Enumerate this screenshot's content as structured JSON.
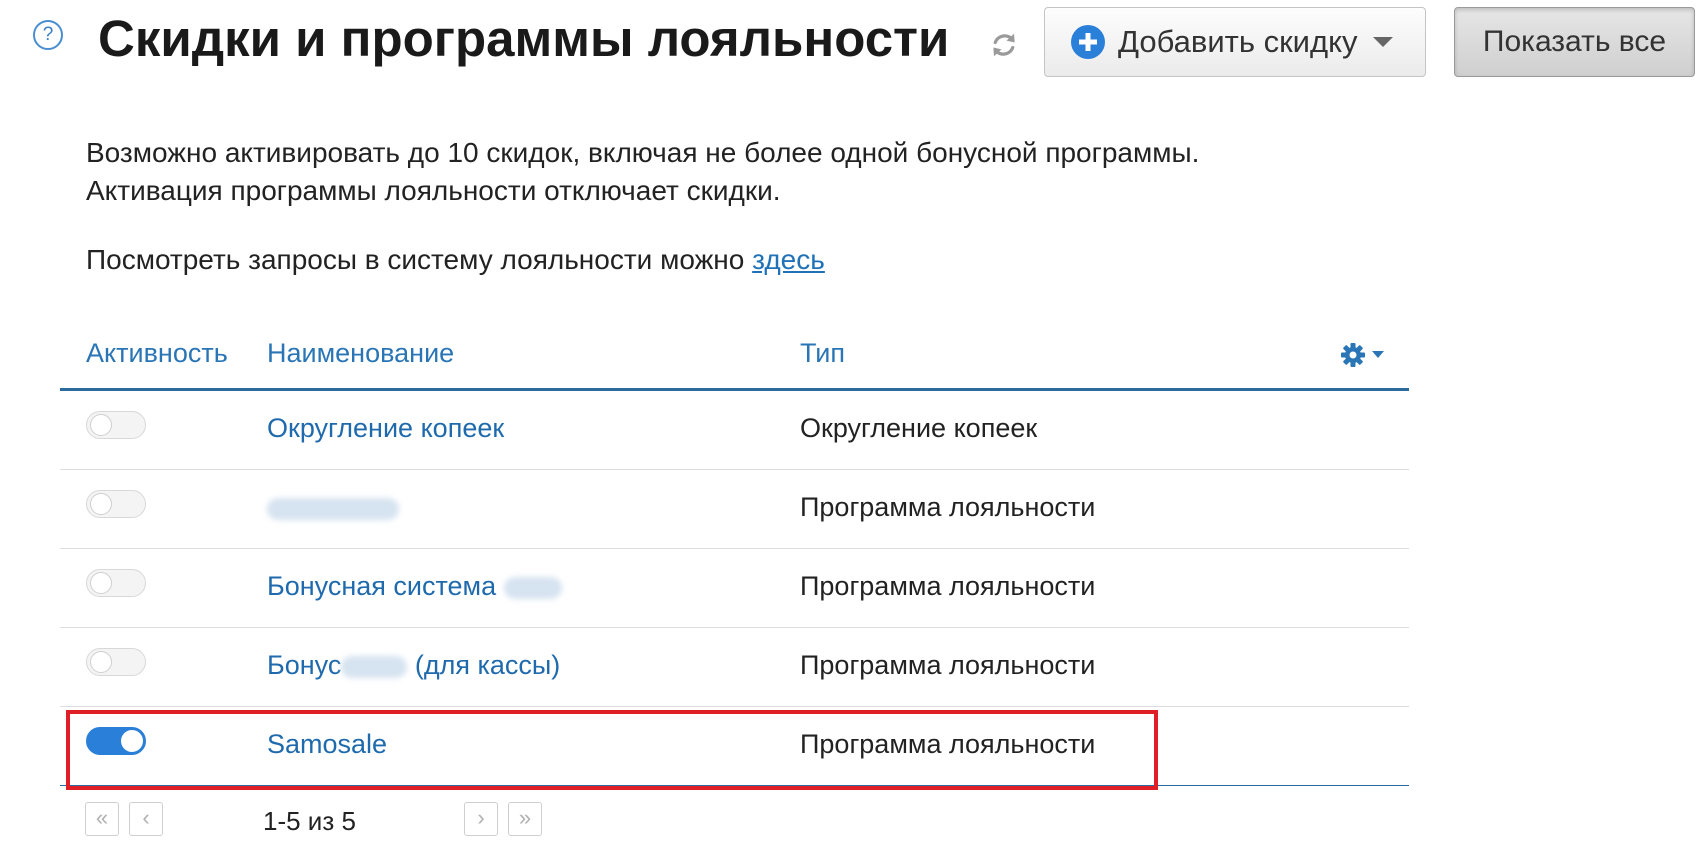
{
  "header": {
    "help_icon": "question-icon",
    "help_glyph": "?",
    "title": "Скидки и программы лояльности",
    "refresh_icon": "refresh-icon",
    "add_button": {
      "icon": "plus-circle-icon",
      "label": "Добавить скидку",
      "dropdown_icon": "caret-down-icon"
    },
    "show_all_label": "Показать все"
  },
  "intro": {
    "line1": "Возможно активировать до 10 скидок, включая не более одной бонусной программы.",
    "line2": "Активация программы лояльности отключает скидки.",
    "requests_text": "Посмотреть запросы в систему лояльности можно ",
    "requests_link": "здесь"
  },
  "table": {
    "columns": {
      "activity": "Активность",
      "name": "Наименование",
      "type": "Тип"
    },
    "settings_icon": "gear-icon",
    "rows": [
      {
        "active": false,
        "name": "Округление копеек",
        "type": "Округление копеек"
      },
      {
        "active": false,
        "name": "",
        "type": "Программа лояльности"
      },
      {
        "active": false,
        "name": "Бонусная система",
        "type": "Программа лояльности"
      },
      {
        "active": false,
        "name_prefix": "Бонус",
        "name_suffix": " (для кассы)",
        "type": "Программа лояльности"
      },
      {
        "active": true,
        "name": "Samosale",
        "type": "Программа лояльности"
      }
    ]
  },
  "pager": {
    "first_glyph": "«",
    "prev_glyph": "‹",
    "next_glyph": "›",
    "last_glyph": "»",
    "info": "1-5 из 5"
  },
  "colors": {
    "accent": "#2a7fd8",
    "link": "#1f6aad",
    "header_border": "#2b6a9a",
    "highlight": "#e01e26"
  }
}
